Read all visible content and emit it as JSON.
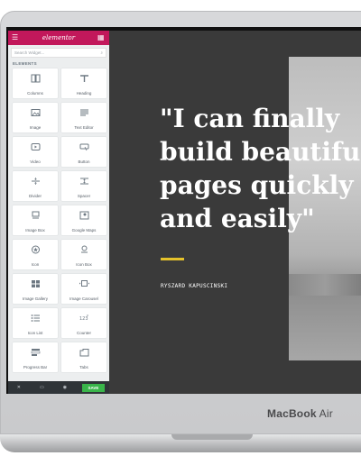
{
  "device": {
    "brand": "MacBook",
    "model": "Air"
  },
  "panel": {
    "logo": "elementor",
    "search_placeholder": "Search Widget...",
    "section_title": "ELEMENTS",
    "widgets": [
      {
        "label": "Columns",
        "icon": "columns-icon"
      },
      {
        "label": "Heading",
        "icon": "heading-icon"
      },
      {
        "label": "Image",
        "icon": "image-icon"
      },
      {
        "label": "Text Editor",
        "icon": "text-editor-icon"
      },
      {
        "label": "Video",
        "icon": "video-icon"
      },
      {
        "label": "Button",
        "icon": "button-icon"
      },
      {
        "label": "Divider",
        "icon": "divider-icon"
      },
      {
        "label": "Spacer",
        "icon": "spacer-icon"
      },
      {
        "label": "Image Box",
        "icon": "image-box-icon"
      },
      {
        "label": "Google Maps",
        "icon": "google-maps-icon"
      },
      {
        "label": "Icon",
        "icon": "star-icon"
      },
      {
        "label": "Icon Box",
        "icon": "icon-box-icon"
      },
      {
        "label": "Image Gallery",
        "icon": "image-gallery-icon"
      },
      {
        "label": "Image Carousel",
        "icon": "image-carousel-icon"
      },
      {
        "label": "Icon List",
        "icon": "icon-list-icon"
      },
      {
        "label": "Counter",
        "icon": "counter-icon"
      },
      {
        "label": "Progress Bar",
        "icon": "progress-bar-icon"
      },
      {
        "label": "Tabs",
        "icon": "tabs-icon"
      }
    ],
    "footer": {
      "save_label": "SAVE"
    }
  },
  "canvas": {
    "quote": "\"I can finally\nbuild beautiful\npages quickly\nand easily\"",
    "author": "RYSZARD KAPUSCINSKI",
    "accent_color": "#e5c22b"
  }
}
